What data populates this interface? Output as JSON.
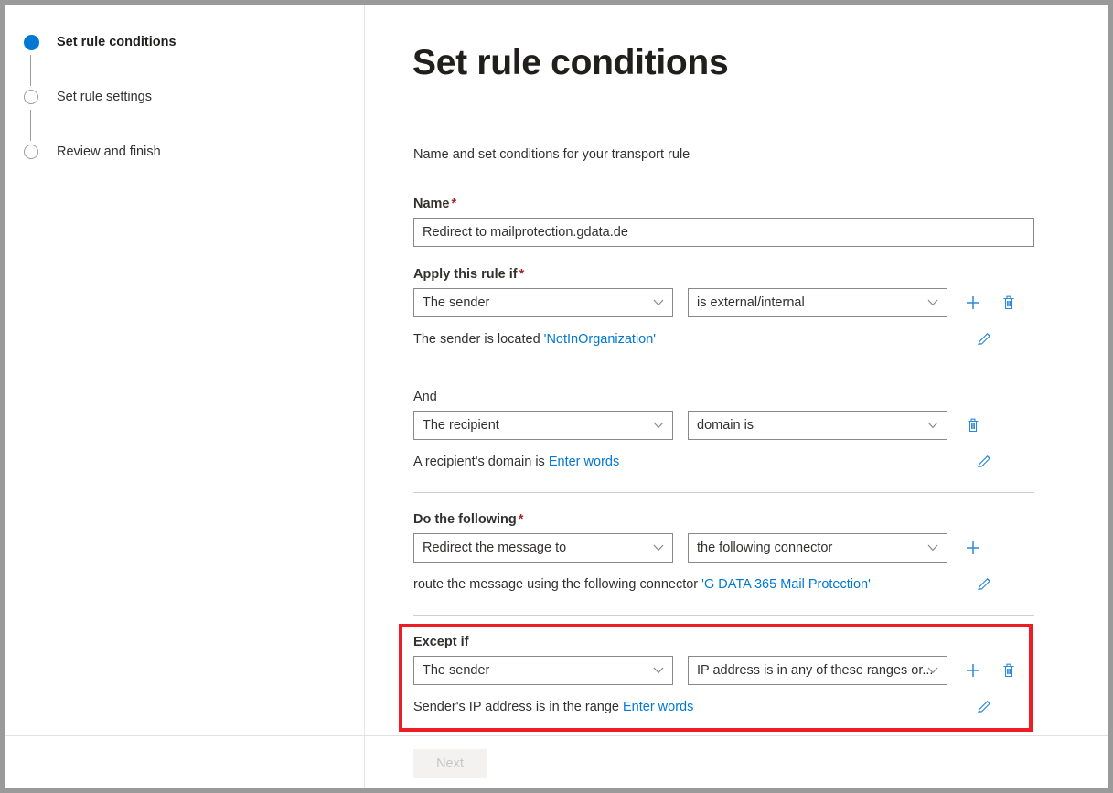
{
  "sidebar": {
    "steps": [
      {
        "label": "Set rule conditions",
        "state": "active"
      },
      {
        "label": "Set rule settings",
        "state": "idle"
      },
      {
        "label": "Review and finish",
        "state": "idle"
      }
    ]
  },
  "main": {
    "title": "Set rule conditions",
    "subtitle": "Name and set conditions for your transport rule",
    "name_field": {
      "label": "Name",
      "required_marker": "*",
      "value": "Redirect to mailprotection.gdata.de",
      "placeholder": "Name"
    },
    "sections": [
      {
        "label": "Apply this rule if",
        "required_marker": "*",
        "label_bold": true,
        "left_select": "The sender",
        "right_select": "is external/internal",
        "desc_prefix": "The sender is located ",
        "desc_link": "'NotInOrganization'",
        "has_add": true,
        "has_trash": true
      },
      {
        "label": "And",
        "required_marker": "",
        "label_bold": false,
        "left_select": "The recipient",
        "right_select": "domain is",
        "desc_prefix": "A recipient's domain is ",
        "desc_link": "Enter words",
        "has_add": false,
        "has_trash": true
      },
      {
        "label": "Do the following",
        "required_marker": "*",
        "label_bold": true,
        "left_select": "Redirect the message to",
        "right_select": "the following connector",
        "desc_prefix": "route the message using the following connector ",
        "desc_link": "'G DATA 365 Mail Protection'",
        "has_add": true,
        "has_trash": false
      },
      {
        "label": "Except if",
        "required_marker": "",
        "label_bold": true,
        "left_select": "The sender",
        "right_select": "IP address is in any of these ranges or...",
        "desc_prefix": "Sender's IP address is in the range ",
        "desc_link": "Enter words",
        "has_add": true,
        "has_trash": true,
        "highlighted": true
      }
    ],
    "footer": {
      "next_label": "Next",
      "next_disabled": true
    }
  },
  "colors": {
    "accent": "#0078d4",
    "required": "#a4262c",
    "highlight": "#ee1c25",
    "link": "#0078d4",
    "border": "#8a8886"
  }
}
